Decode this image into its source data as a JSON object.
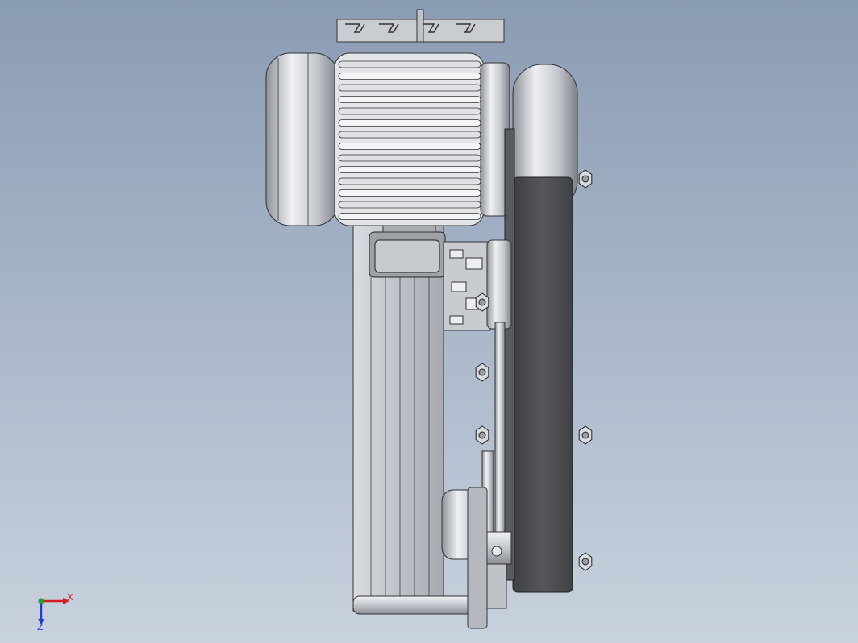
{
  "window": {
    "title": ""
  },
  "model": {
    "description_visible": false
  },
  "triad": {
    "x_label": "X",
    "z_label": "Z",
    "x_color": "#d21f1f",
    "y_color": "#22a03a",
    "z_color": "#1f3fd2"
  },
  "colors": {
    "background_top": "#8a9bb4",
    "background_bottom": "#c9d2de",
    "metal_light": "#e6e8ec",
    "metal_mid": "#b9bdc4",
    "metal_dark": "#6b6f76",
    "belt_cover": "#4b4c50"
  }
}
